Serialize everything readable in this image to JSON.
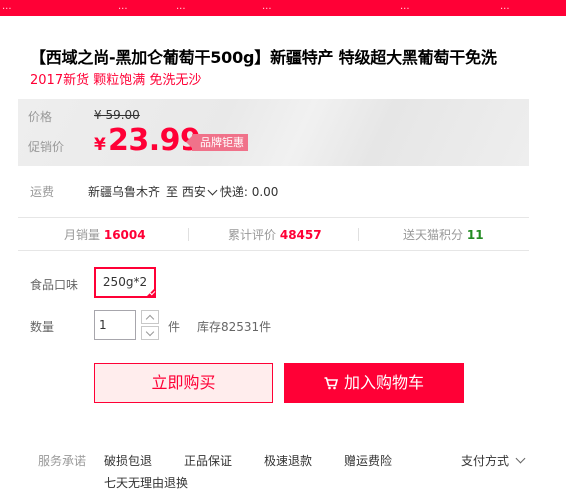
{
  "topbar": {
    "items": [
      "...",
      "...",
      "...",
      "...",
      "...",
      "..."
    ]
  },
  "product": {
    "title": "【西域之尚-黑加仑葡萄干500g】新疆特产 特级超大黑葡萄干免洗",
    "subtitle": "2017新货 颗粒饱满 免洗无沙"
  },
  "price": {
    "label": "价格",
    "original": "¥ 59.00",
    "promo_label": "促销价",
    "currency": "¥",
    "promo_value": "23.99",
    "badge": "品牌钜惠"
  },
  "shipping": {
    "label": "运费",
    "from": "新疆乌鲁木齐",
    "to_prefix": "至",
    "to": "西安",
    "express": "快递: 0.00"
  },
  "stats": {
    "monthly_sales_label": "月销量",
    "monthly_sales_value": "16004",
    "reviews_label": "累计评价",
    "reviews_value": "48457",
    "points_label": "送天猫积分",
    "points_value": "11"
  },
  "sku": {
    "flavor_label": "食品口味",
    "flavor_selected": "250g*2",
    "quantity_label": "数量",
    "quantity_value": "1",
    "unit": "件",
    "stock": "库存82531件"
  },
  "actions": {
    "buy_now": "立即购买",
    "add_to_cart": "加入购物车"
  },
  "services": {
    "label": "服务承诺",
    "items": [
      "破损包退",
      "正品保证",
      "极速退款",
      "赠运费险"
    ],
    "extra": "七天无理由退换",
    "payment": "支付方式"
  },
  "colors": {
    "accent": "#ff0036",
    "badge_bg": "#f0728a",
    "buy_bg": "#ffeded",
    "green": "#228b22"
  }
}
